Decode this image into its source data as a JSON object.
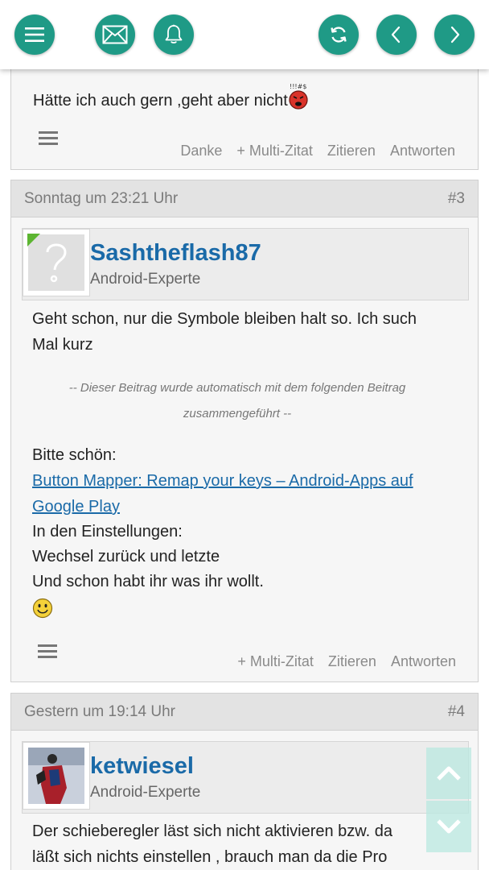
{
  "toolbar": {
    "menu_icon": "menu-icon",
    "messages_icon": "envelope-icon",
    "notifications_icon": "bell-icon",
    "refresh_icon": "refresh-icon",
    "back_icon": "chevron-left-icon",
    "forward_icon": "chevron-right-icon",
    "accent_color": "#1f9a86"
  },
  "post2": {
    "text": "Hätte ich auch gern ,geht aber nicht",
    "emoji_icon": "angry-face-icon",
    "actions": {
      "thanks": "Danke",
      "multiquote": "+ Multi-Zitat",
      "quote": "Zitieren",
      "reply": "Antworten"
    }
  },
  "post3": {
    "date": "Sonntag um 23:21 Uhr",
    "number": "#3",
    "author": "Sashtheflash87",
    "role": "Android-Experte",
    "line1": "Geht schon, nur die Symbole bleiben halt so. Ich such",
    "line2": "Mal kurz",
    "merge_note_1": "-- Dieser Beitrag wurde automatisch mit dem folgenden Beitrag",
    "merge_note_2": "zusammengeführt --",
    "line3": "Bitte schön:",
    "link_line1": "Button Mapper: Remap your keys – Android-Apps auf",
    "link_line2": "Google Play",
    "line4": "In den Einstellungen:",
    "line5": "Wechsel zurück und letzte",
    "line6": "Und schon habt ihr was ihr wollt.",
    "emoji_icon": "smiley-icon",
    "actions": {
      "multiquote": "+ Multi-Zitat",
      "quote": "Zitieren",
      "reply": "Antworten"
    }
  },
  "post4": {
    "date": "Gestern um 19:14 Uhr",
    "number": "#4",
    "author": "ketwiesel",
    "role": "Android-Experte",
    "line1": "Der schieberegler läst sich nicht aktivieren bzw. da",
    "line2": "läßt sich nichts einstellen , brauch man da die Pro"
  },
  "scroll": {
    "up_icon": "chevron-up-icon",
    "down_icon": "chevron-down-icon"
  }
}
